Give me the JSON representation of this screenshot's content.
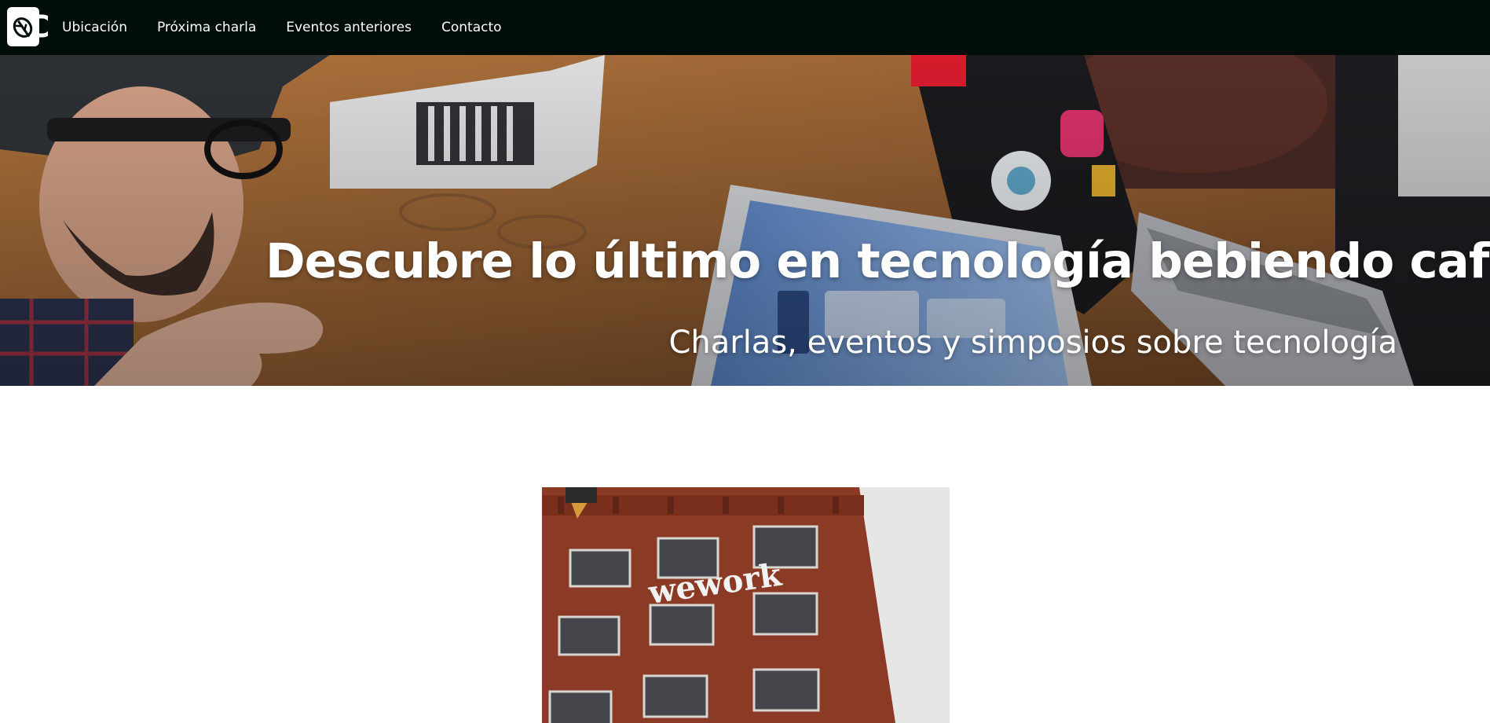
{
  "nav": {
    "logo_icon": "coffee-mug-leaf-icon",
    "links": [
      "Ubicación",
      "Próxima charla",
      "Eventos anteriores",
      "Contacto"
    ]
  },
  "hero": {
    "title": "Descubre lo último en tecnología bebiendo café",
    "subtitle": "Charlas, eventos y simposios sobre tecnología"
  },
  "venue": {
    "sign": "wework"
  },
  "colors": {
    "navbar_bg": "#000d08",
    "text": "#ffffff",
    "brick": "#8a3a25"
  }
}
